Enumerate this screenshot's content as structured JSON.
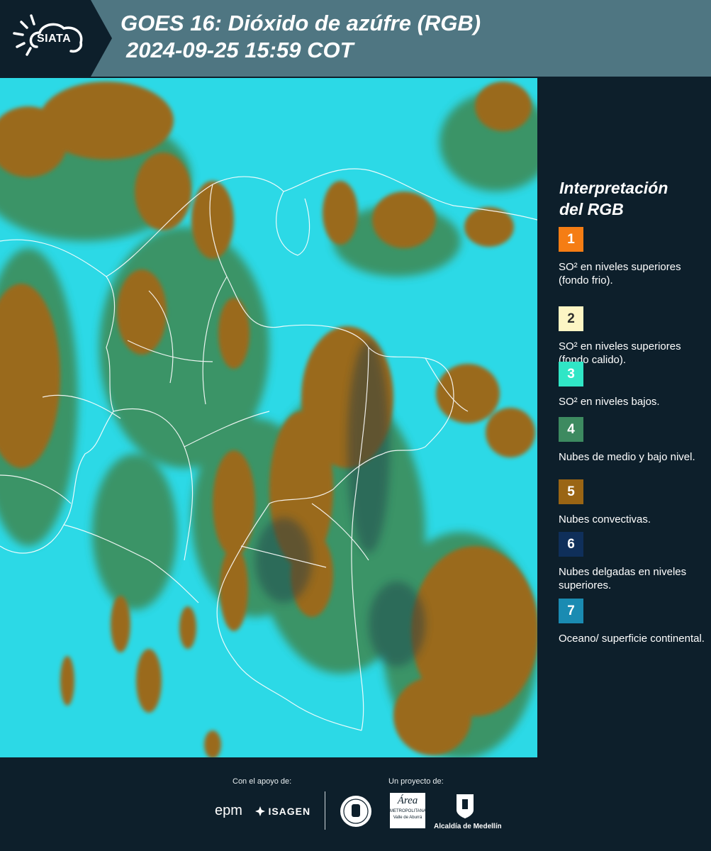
{
  "header": {
    "logo_text": "SIATA",
    "title_line1": "GOES 16: Dióxido de azúfre (RGB)",
    "title_line2": "2024-09-25 15:59 COT"
  },
  "legend": {
    "title_line1": "Interpretación",
    "title_line2": "del RGB",
    "items": [
      {
        "number": "1",
        "color": "#f57d14",
        "label": "SO² en niveles superiores (fondo frio)."
      },
      {
        "number": "2",
        "color": "#fdf5c4",
        "label": "SO² en niveles superiores (fondo calido)."
      },
      {
        "number": "3",
        "color": "#30e6c6",
        "label": "SO² en niveles bajos."
      },
      {
        "number": "4",
        "color": "#3d8a60",
        "label": "Nubes de medio y bajo nivel."
      },
      {
        "number": "5",
        "color": "#9a6514",
        "label": "Nubes convectivas."
      },
      {
        "number": "6",
        "color": "#0f2f5a",
        "label": "Nubes delgadas en niveles superiores."
      },
      {
        "number": "7",
        "color": "#1a8bb2",
        "label": "Oceano/ superficie continental."
      }
    ]
  },
  "footer": {
    "support_label": "Con el apoyo de:",
    "project_label": "Un proyecto de:",
    "sponsor1": "epm",
    "sponsor2": "ISAGEN",
    "partner_area_line1": "Área",
    "partner_area_line2": "METROPOLITANA",
    "partner_area_line3": "Valle de Aburrá",
    "partner_medellin": "Alcaldía de Medellín"
  },
  "colors": {
    "header_bg": "#4f7682",
    "panel_bg": "#0d1f2b",
    "map_background": "#2cd9e6",
    "cloud_convective": "#9a6a1c",
    "cloud_mid": "#3f7d3c"
  }
}
